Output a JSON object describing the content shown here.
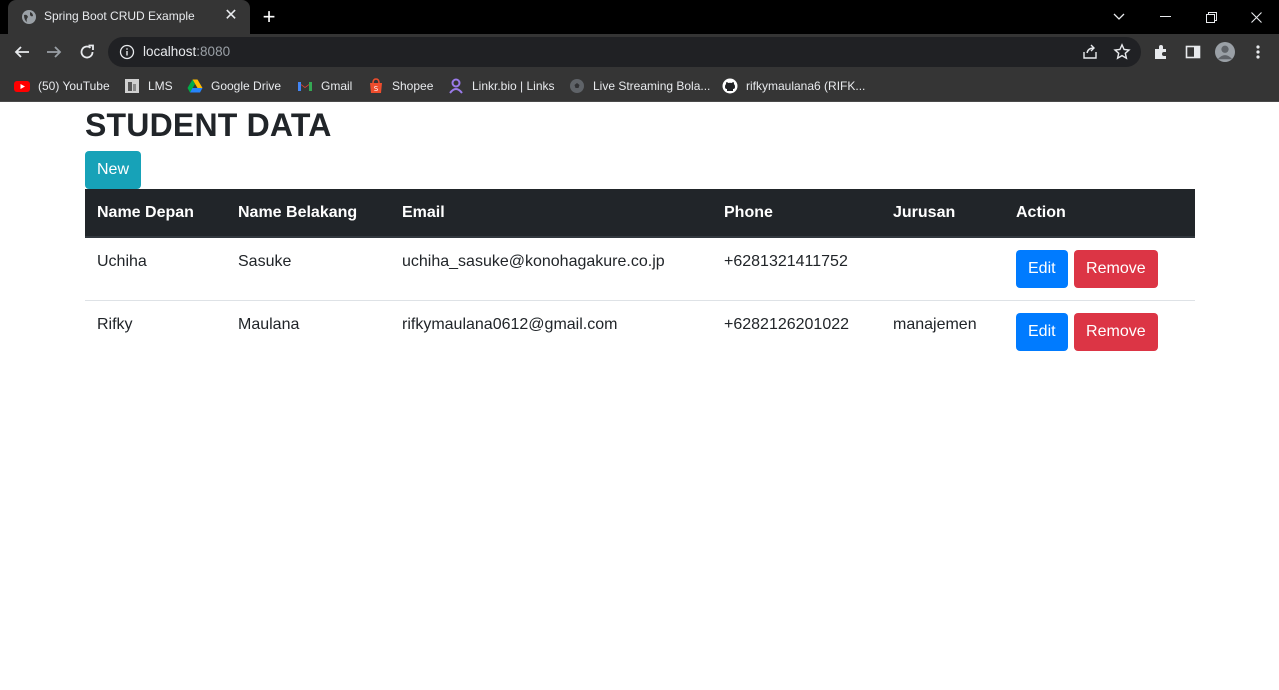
{
  "browser": {
    "tab_title": "Spring Boot CRUD Example",
    "url_host": "localhost",
    "url_port": ":8080",
    "bookmarks": [
      {
        "label": "(50) YouTube",
        "icon": "youtube-icon"
      },
      {
        "label": "LMS",
        "icon": "lms-icon"
      },
      {
        "label": "Google Drive",
        "icon": "google-drive-icon"
      },
      {
        "label": "Gmail",
        "icon": "gmail-icon"
      },
      {
        "label": "Shopee",
        "icon": "shopee-icon"
      },
      {
        "label": "Linkr.bio | Links",
        "icon": "linkr-icon"
      },
      {
        "label": "Live Streaming Bola...",
        "icon": "soccer-ball-icon"
      },
      {
        "label": "rifkymaulana6 (RIFK...",
        "icon": "github-icon"
      }
    ]
  },
  "page": {
    "title": "STUDENT DATA",
    "new_button": "New",
    "columns": [
      "Name Depan",
      "Name Belakang",
      "Email",
      "Phone",
      "Jurusan",
      "Action"
    ],
    "rows": [
      {
        "first": "Uchiha",
        "last": "Sasuke",
        "email": "uchiha_sasuke@konohagakure.co.jp",
        "phone": "+6281321411752",
        "jurusan": "",
        "edit": "Edit",
        "remove": "Remove"
      },
      {
        "first": "Rifky",
        "last": "Maulana",
        "email": "rifkymaulana0612@gmail.com",
        "phone": "+6282126201022",
        "jurusan": "manajemen",
        "edit": "Edit",
        "remove": "Remove"
      }
    ]
  },
  "colors": {
    "header_bg": "#212529",
    "new_button": "#17a2b8",
    "edit_button": "#007bff",
    "remove_button": "#dc3545"
  }
}
